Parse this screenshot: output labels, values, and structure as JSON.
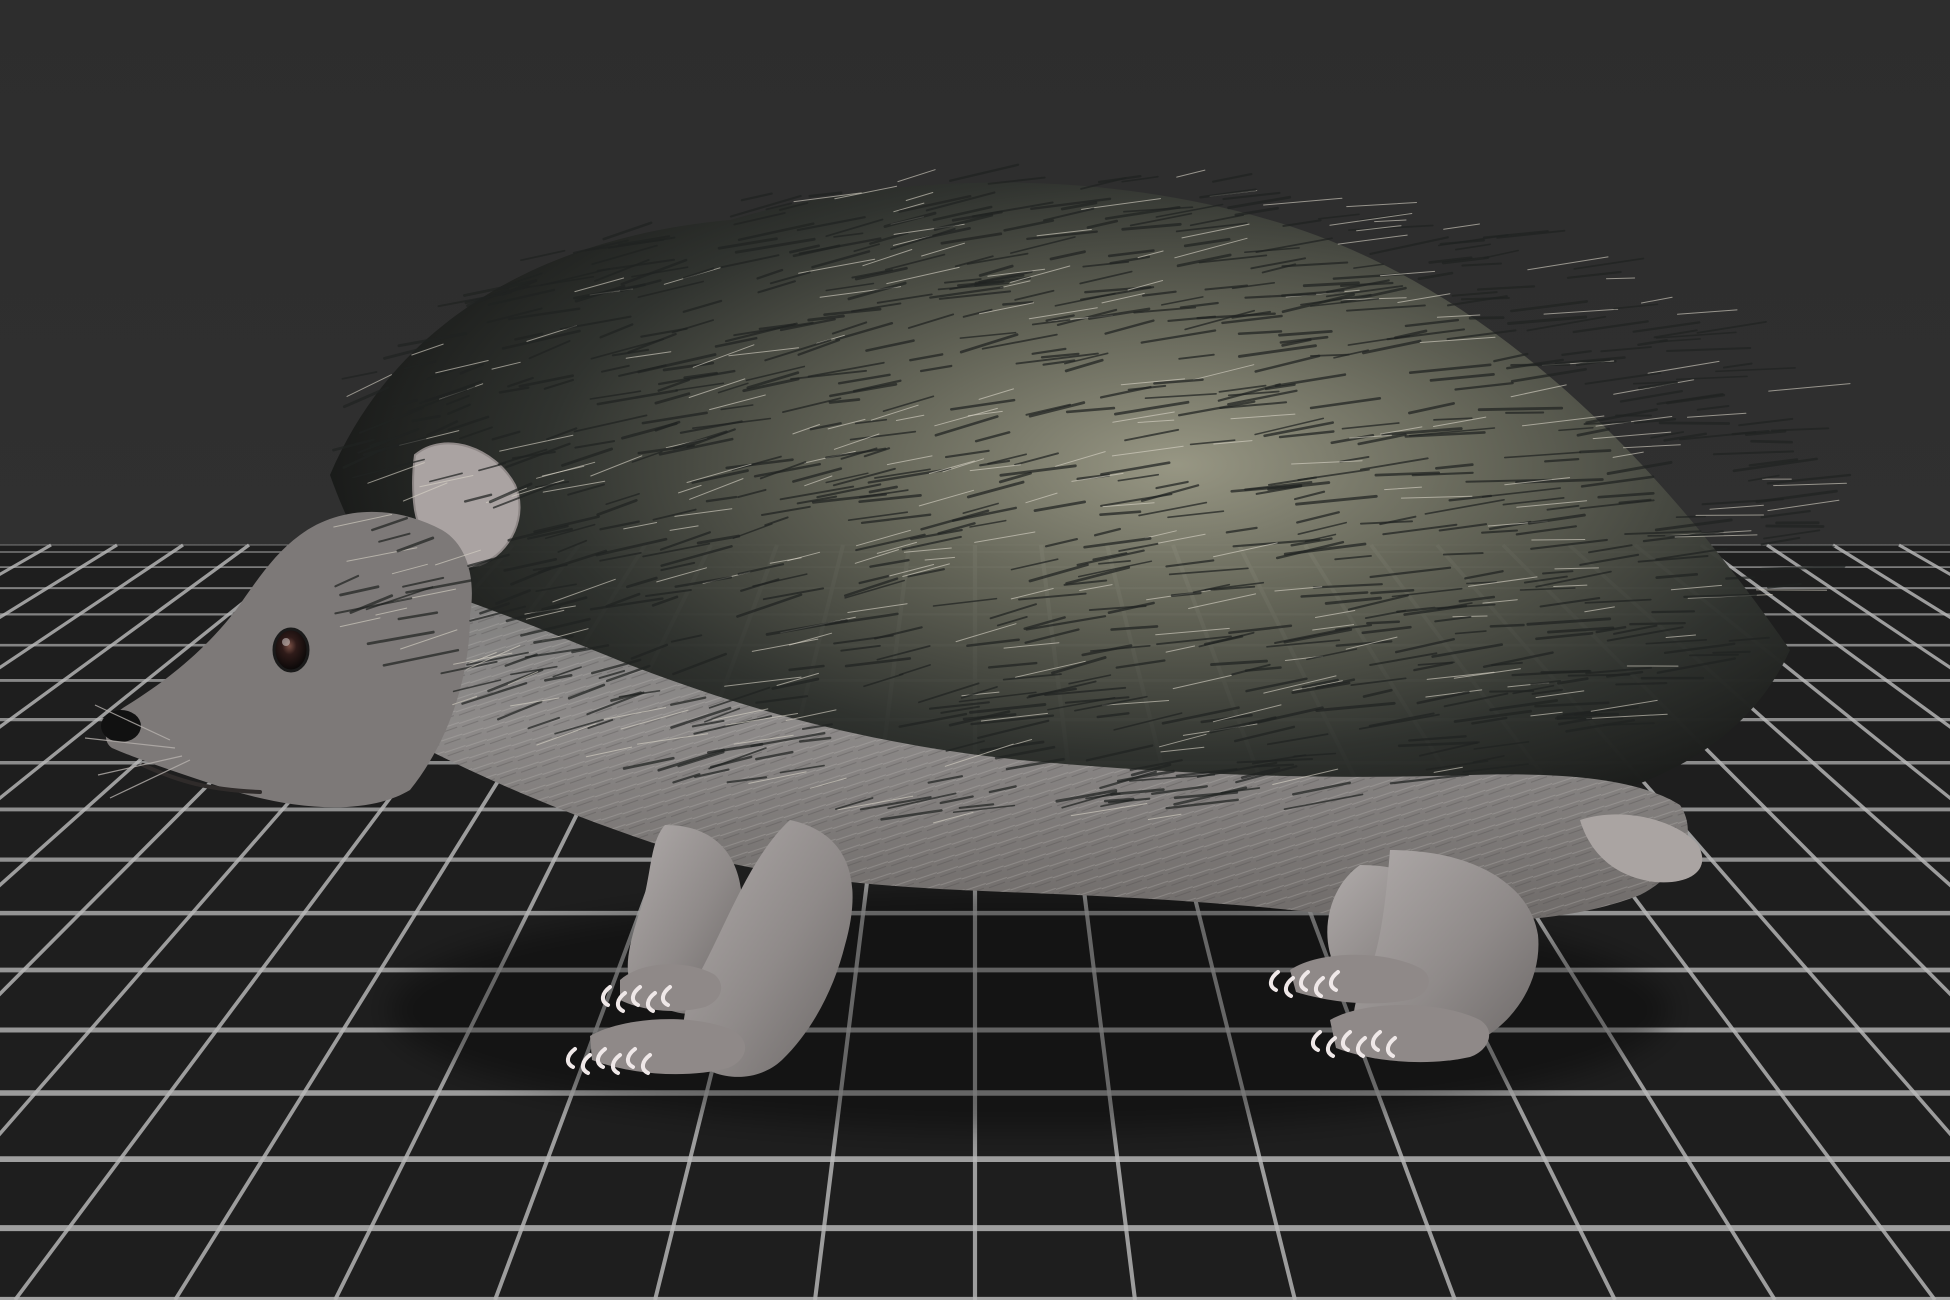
{
  "viewport": {
    "background_color": "#2f2f2f",
    "floor_grid_color": "#b9b9b9",
    "floor_color": "#1b1b1b"
  },
  "model": {
    "subject": "hedgehog",
    "body_color": "#8e8b89",
    "skin_color": "#aaa5a2",
    "spine_dark_color": "#202321",
    "spine_light_color": "#d8d4c6",
    "claw_color": "#efe8e8"
  },
  "status": {
    "text": "",
    "text_color": "#6f6f6f"
  }
}
